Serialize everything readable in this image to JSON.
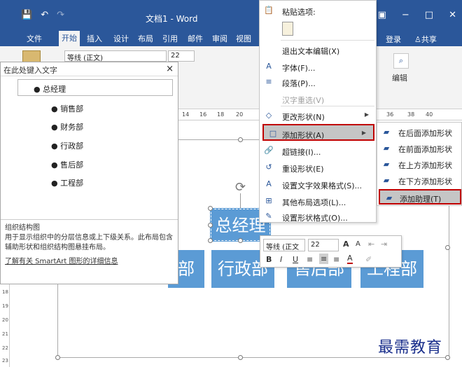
{
  "titlebar": {
    "doc_title": "文档1 - Word",
    "save_glyph": "💾",
    "undo_glyph": "↶",
    "redo_glyph": "↷",
    "min_glyph": "−",
    "max_glyph": "□",
    "close_glyph": "✕",
    "options_glyph": "▣"
  },
  "tabs": {
    "file": "文件",
    "home": "开始",
    "insert": "插入",
    "design": "设计",
    "layout": "布局",
    "references": "引用",
    "mailings": "邮件",
    "review": "审阅",
    "view": "视图",
    "login": "登录",
    "share": "共享"
  },
  "ribbon": {
    "font_name": "等线 (正文)",
    "font_size": "22",
    "edit_label": "编辑"
  },
  "ruler": {
    "h_left": [
      "14",
      "16",
      "18",
      "20"
    ],
    "h_right": [
      "36",
      "38",
      "40"
    ],
    "v": [
      "18",
      "19",
      "20",
      "21",
      "22",
      "23"
    ]
  },
  "textpane": {
    "title": "在此处键入文字",
    "close": "×",
    "items": [
      {
        "text": "总经理",
        "level": 0
      },
      {
        "text": "销售部",
        "level": 1
      },
      {
        "text": "财务部",
        "level": 1
      },
      {
        "text": "行政部",
        "level": 1
      },
      {
        "text": "售后部",
        "level": 1
      },
      {
        "text": "工程部",
        "level": 1
      }
    ],
    "info_title": "组织结构图",
    "info_body": "用于显示组织中的分层信息或上下级关系。此布局包含辅助形状和组织结构图悬挂布局。",
    "info_link": "了解有关 SmartArt 图形的详细信息"
  },
  "diagram": {
    "boss": "总经理",
    "depts": [
      "部",
      "行政部",
      "售后部",
      "工程部"
    ]
  },
  "context_menu": {
    "paste_options": "粘贴选项:",
    "exit_edit": "退出文本编辑(X)",
    "font": "字体(F)...",
    "paragraph": "段落(P)...",
    "hanzi": "汉字重选(V)",
    "change_shape": "更改形状(N)",
    "add_shape": "添加形状(A)",
    "hyperlink": "超链接(I)...",
    "reset_shape": "重设形状(E)",
    "text_effects": "设置文字效果格式(S)...",
    "layout_options": "其他布局选项(L)...",
    "shape_format": "设置形状格式(O)..."
  },
  "submenu": {
    "after": "在后面添加形状",
    "before": "在前面添加形状",
    "above": "在上方添加形状",
    "below": "在下方添加形状",
    "assistant": "添加助理(T)"
  },
  "minibar": {
    "font": "等线 (正文",
    "size": "22",
    "bold": "B",
    "italic": "I",
    "underline": "U",
    "grow": "A",
    "shrink": "A"
  },
  "watermark": "最需教育",
  "colors": {
    "word_blue": "#2b579a",
    "shape_blue": "#5b9bd5",
    "highlight_border": "#c00000"
  }
}
